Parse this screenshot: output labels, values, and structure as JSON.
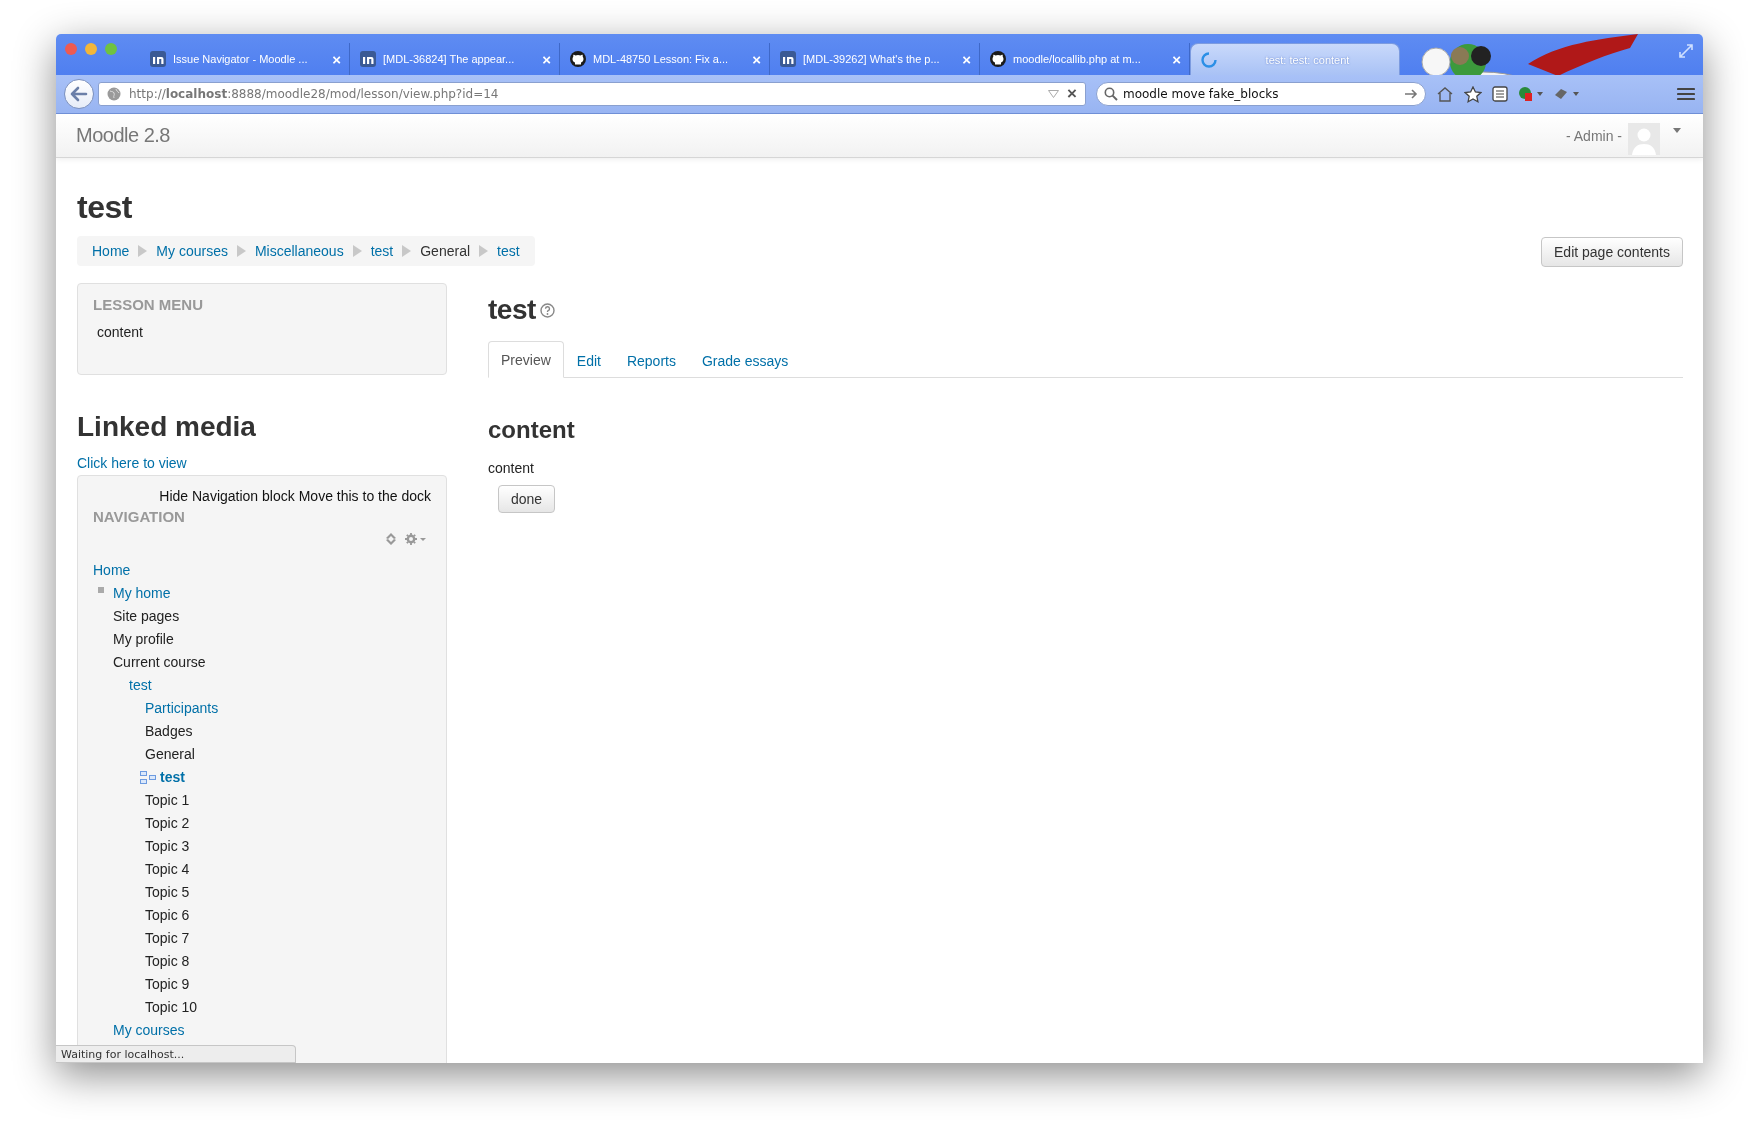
{
  "browser": {
    "tabs": [
      {
        "label": "Issue Navigator - Moodle ...",
        "kind": "jira",
        "selected": false
      },
      {
        "label": "[MDL-36824] The appear...",
        "kind": "jira",
        "selected": false
      },
      {
        "label": "MDL-48750 Lesson: Fix a...",
        "kind": "github",
        "selected": false
      },
      {
        "label": "[MDL-39262] What's the p...",
        "kind": "jira",
        "selected": false
      },
      {
        "label": "moodle/locallib.php at m...",
        "kind": "github",
        "selected": false
      },
      {
        "label": "test: test: content",
        "kind": "loading",
        "selected": true
      }
    ],
    "tab_close": "×",
    "url": "http://**localhost**:8888/moodle28/mod/lesson/view.php?id=14",
    "url_clear": "×",
    "search": {
      "value": "moodle move fake_blocks"
    },
    "status_bar": "Waiting for localhost..."
  },
  "site": {
    "brand": "Moodle 2.8",
    "user": "- Admin -"
  },
  "page": {
    "title": "test",
    "breadcrumb": [
      {
        "label": "Home",
        "kind": "link"
      },
      {
        "label": "My courses",
        "kind": "link"
      },
      {
        "label": "Miscellaneous",
        "kind": "link"
      },
      {
        "label": "test",
        "kind": "link"
      },
      {
        "label": "General",
        "kind": "text"
      },
      {
        "label": "test",
        "kind": "link"
      }
    ],
    "edit_button": "Edit page contents"
  },
  "lesson_menu": {
    "title": "LESSON MENU",
    "items": [
      "content"
    ]
  },
  "linked_media": {
    "title": "Linked media",
    "link": "Click here to view"
  },
  "navigation": {
    "skip_links": [
      "Hide Navigation block",
      "Move this to the dock"
    ],
    "title": "NAVIGATION",
    "tree": [
      {
        "label": "Home",
        "kind": "link",
        "children": [
          {
            "label": "My home",
            "kind": "branch"
          },
          {
            "label": "Site pages",
            "kind": "text"
          },
          {
            "label": "My profile",
            "kind": "text"
          },
          {
            "label": "Current course",
            "kind": "text",
            "children": [
              {
                "label": "test",
                "kind": "link",
                "children": [
                  {
                    "label": "Participants",
                    "kind": "link"
                  },
                  {
                    "label": "Badges",
                    "kind": "text"
                  },
                  {
                    "label": "General",
                    "kind": "text"
                  },
                  {
                    "label": "test",
                    "kind": "current"
                  },
                  {
                    "label": "Topic 1",
                    "kind": "text"
                  },
                  {
                    "label": "Topic 2",
                    "kind": "text"
                  },
                  {
                    "label": "Topic 3",
                    "kind": "text"
                  },
                  {
                    "label": "Topic 4",
                    "kind": "text"
                  },
                  {
                    "label": "Topic 5",
                    "kind": "text"
                  },
                  {
                    "label": "Topic 6",
                    "kind": "text"
                  },
                  {
                    "label": "Topic 7",
                    "kind": "text"
                  },
                  {
                    "label": "Topic 8",
                    "kind": "text"
                  },
                  {
                    "label": "Topic 9",
                    "kind": "text"
                  },
                  {
                    "label": "Topic 10",
                    "kind": "text"
                  }
                ]
              }
            ]
          },
          {
            "label": "My courses",
            "kind": "link"
          }
        ]
      }
    ]
  },
  "lesson": {
    "title": "test",
    "tabs": [
      {
        "label": "Preview",
        "selected": true
      },
      {
        "label": "Edit",
        "selected": false
      },
      {
        "label": "Reports",
        "selected": false
      },
      {
        "label": "Grade essays",
        "selected": false
      }
    ],
    "heading": "content",
    "text": "content",
    "button": "done"
  }
}
